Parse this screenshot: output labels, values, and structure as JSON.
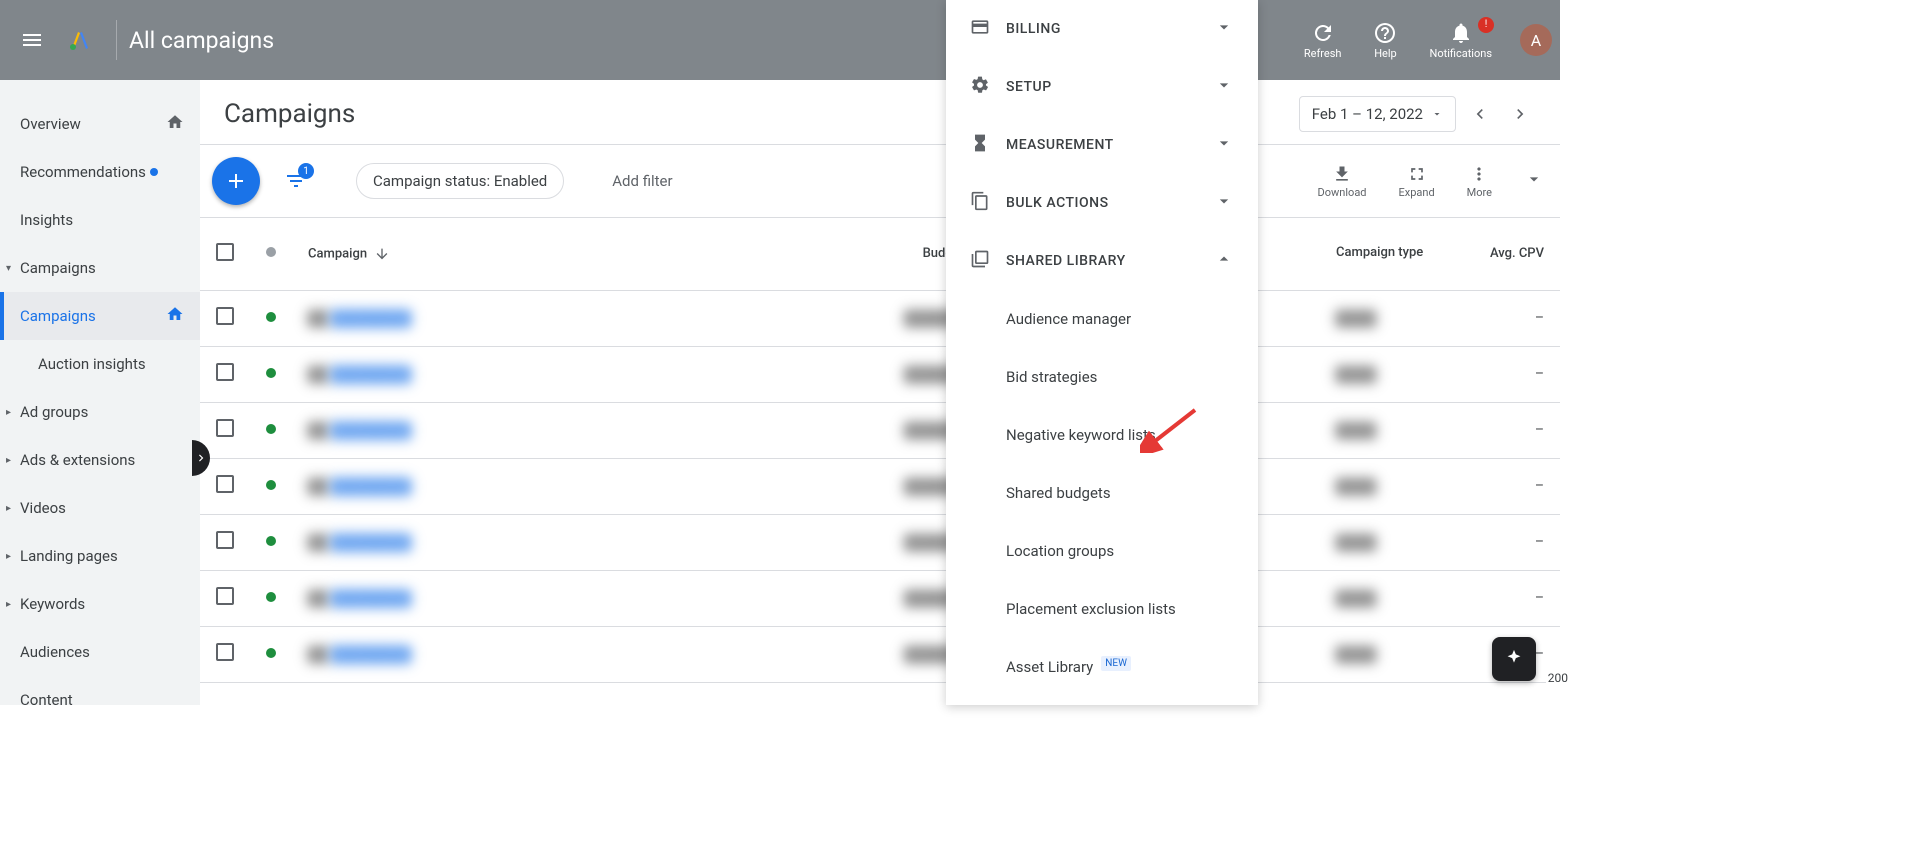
{
  "header": {
    "title": "All campaigns",
    "actions": {
      "refresh": "Refresh",
      "help": "Help",
      "notifications": "Notifications",
      "notif_badge": "!"
    },
    "avatar_initial": "A"
  },
  "sidebar": {
    "items": [
      {
        "label": "Overview",
        "home_icon": true
      },
      {
        "label": "Recommendations",
        "dot": true
      },
      {
        "label": "Insights"
      },
      {
        "label": "Campaigns",
        "expandable": true,
        "expanded": true
      },
      {
        "label": "Campaigns",
        "sub": true,
        "active": true,
        "home_icon": true
      },
      {
        "label": "Auction insights",
        "sub": true
      },
      {
        "label": "Ad groups",
        "expandable": true
      },
      {
        "label": "Ads & extensions",
        "expandable": true
      },
      {
        "label": "Videos",
        "expandable": true
      },
      {
        "label": "Landing pages",
        "expandable": true
      },
      {
        "label": "Keywords",
        "expandable": true
      },
      {
        "label": "Audiences"
      },
      {
        "label": "Content"
      }
    ]
  },
  "page": {
    "title": "Campaigns",
    "date_range": "Feb 1 – 12, 2022"
  },
  "toolbar": {
    "filter_count": "1",
    "filter_chip": "Campaign status: Enabled",
    "add_filter": "Add filter",
    "download": "Download",
    "expand": "Expand",
    "more": "More"
  },
  "table": {
    "columns": {
      "campaign": "Campaign",
      "budget": "Budget",
      "campaign_type": "Campaign type",
      "avg_cpv": "Avg. CPV"
    },
    "rows": [
      {
        "avg_cpv": "–"
      },
      {
        "avg_cpv": "–"
      },
      {
        "avg_cpv": "–"
      },
      {
        "avg_cpv": "–"
      },
      {
        "avg_cpv": "–"
      },
      {
        "avg_cpv": "–"
      },
      {
        "avg_cpv": "–"
      }
    ]
  },
  "tools_panel": {
    "sections": [
      {
        "title": "BILLING",
        "icon": "card"
      },
      {
        "title": "SETUP",
        "icon": "gear"
      },
      {
        "title": "MEASUREMENT",
        "icon": "hourglass"
      },
      {
        "title": "BULK ACTIONS",
        "icon": "copy"
      },
      {
        "title": "SHARED LIBRARY",
        "icon": "library",
        "expanded": true
      }
    ],
    "shared_library_items": [
      "Audience manager",
      "Bid strategies",
      "Negative keyword lists",
      "Shared budgets",
      "Location groups",
      "Placement exclusion lists"
    ],
    "asset_library": "Asset Library",
    "new_badge": "NEW"
  },
  "zoom": "200"
}
